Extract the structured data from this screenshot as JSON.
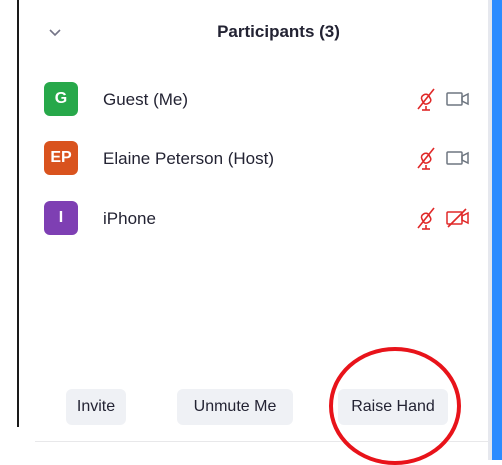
{
  "panel": {
    "title": "Participants (3)"
  },
  "participants": [
    {
      "initials": "G",
      "name": "Guest (Me)",
      "avatar_color": "#27a84a",
      "mic": "mic-muted-icon",
      "video": "video-icon"
    },
    {
      "initials": "EP",
      "name": "Elaine Peterson (Host)",
      "avatar_color": "#d9531e",
      "mic": "mic-muted-icon",
      "video": "video-icon"
    },
    {
      "initials": "I",
      "name": "iPhone",
      "avatar_color": "#7e3fb3",
      "mic": "mic-muted-icon",
      "video": "video-off-icon"
    }
  ],
  "buttons": {
    "invite": "Invite",
    "unmute": "Unmute Me",
    "raise_hand": "Raise Hand"
  },
  "colors": {
    "muted_red": "#e02828",
    "icon_gray": "#6e7680",
    "button_bg": "#eff1f5",
    "annotation_red": "#e8131a",
    "accent_blue": "#2d8cff"
  }
}
